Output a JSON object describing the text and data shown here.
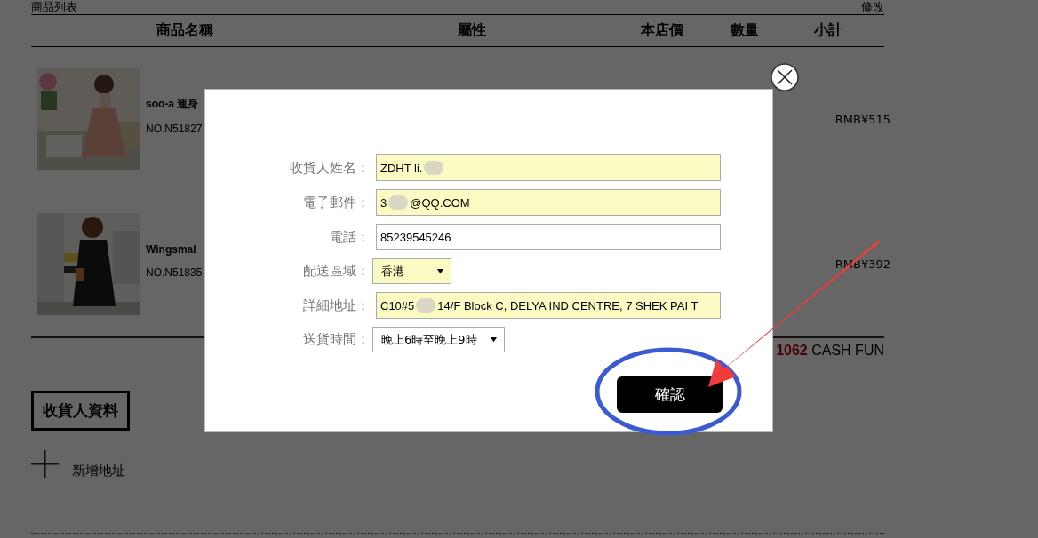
{
  "product_list": {
    "title": "商品列表",
    "edit_link": "修改",
    "columns": [
      "商品名稱",
      "屬性",
      "本店價",
      "數量",
      "小計"
    ],
    "items": [
      {
        "name": "soo-a 連身",
        "code": "NO.N51827",
        "subtotal": "RMB¥515"
      },
      {
        "name": "Wingsmal",
        "code": "NO.N51835",
        "subtotal": "RMB¥392"
      }
    ],
    "total_amount": "1062",
    "total_unit": "CASH FUN"
  },
  "recipient_section": {
    "title": "收貨人資料",
    "add_address": "新增地址"
  },
  "dialog": {
    "fields": [
      {
        "kind": "text",
        "label": "收貨人姓名：",
        "value": "ZDHT li.",
        "redacted": true,
        "autofilled": true
      },
      {
        "kind": "text",
        "label": "電子郵件：",
        "value": "3",
        "redacted": true,
        "value_end": "@QQ.COM",
        "autofilled": true
      },
      {
        "kind": "text",
        "label": "電話：",
        "value": "85239545246",
        "redacted": false,
        "autofilled": false
      },
      {
        "kind": "select",
        "label": "配送區域：",
        "value": "香港",
        "autofilled": true
      },
      {
        "kind": "text",
        "label": "詳細地址：",
        "value": "C10#5",
        "redacted": true,
        "value_end": "14/F Block C, DELYA IND CENTRE, 7 SHEK PAI T",
        "autofilled": true
      },
      {
        "kind": "select",
        "label": "送貨時間：",
        "value": "晚上6時至晚上9時",
        "autofilled": false
      }
    ],
    "confirm_button": "確認"
  }
}
